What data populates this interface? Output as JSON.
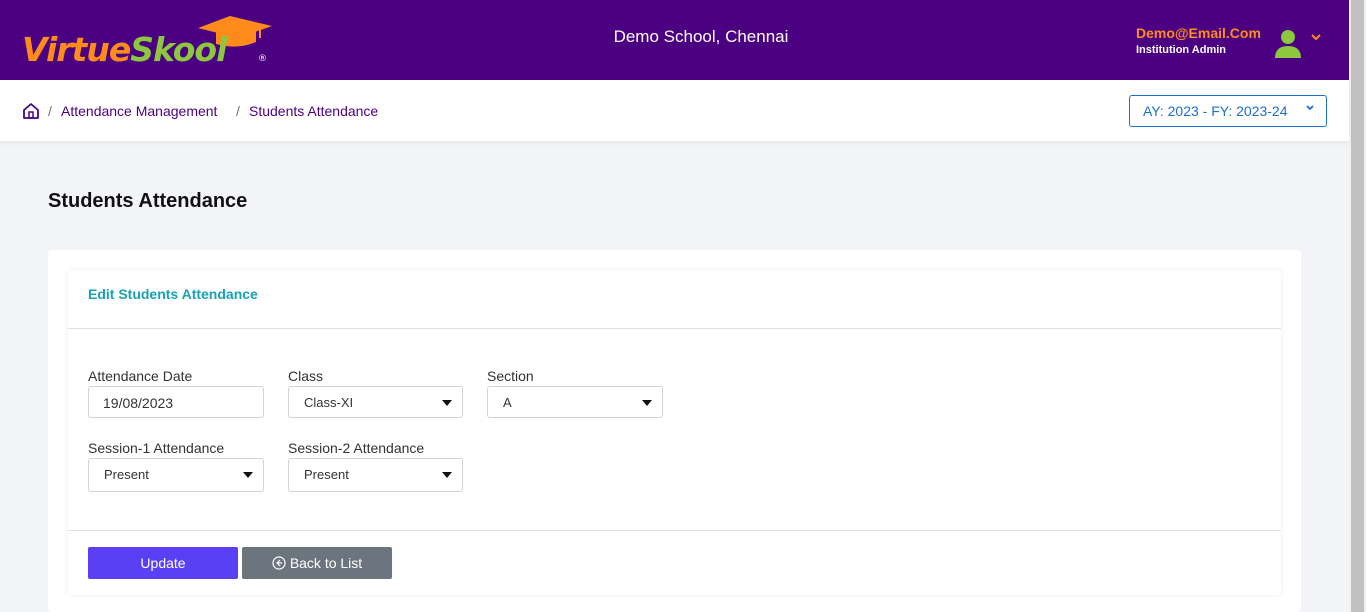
{
  "header": {
    "logo_part1": "Virtue",
    "logo_part2": "Skool",
    "logo_reg": "®",
    "school_name": "Demo School, Chennai",
    "user_email": "Demo@Email.Com",
    "user_role": "Institution Admin"
  },
  "breadcrumb": {
    "items": [
      "Attendance Management",
      "Students Attendance"
    ],
    "separator": "/"
  },
  "year_selector": {
    "value": "AY: 2023 - FY: 2023-24"
  },
  "page": {
    "title": "Students Attendance"
  },
  "card": {
    "title": "Edit Students Attendance"
  },
  "form": {
    "attendance_date": {
      "label": "Attendance Date",
      "value": "19/08/2023"
    },
    "class": {
      "label": "Class",
      "value": "Class-XI"
    },
    "section": {
      "label": "Section",
      "value": "A"
    },
    "session1": {
      "label": "Session-1 Attendance",
      "value": "Present"
    },
    "session2": {
      "label": "Session-2 Attendance",
      "value": "Present"
    }
  },
  "buttons": {
    "update": "Update",
    "back": "Back to List"
  },
  "colors": {
    "header_bg": "#4b0082",
    "accent_orange": "#ff8c1a",
    "accent_green": "#8dc63f",
    "update_btn": "#5a3ff5",
    "back_btn": "#6c757d",
    "card_title": "#17a2b8"
  },
  "icons": [
    "graduation-cap-icon",
    "user-avatar-icon",
    "chevron-down-icon",
    "home-icon",
    "back-circle-arrow-icon"
  ]
}
